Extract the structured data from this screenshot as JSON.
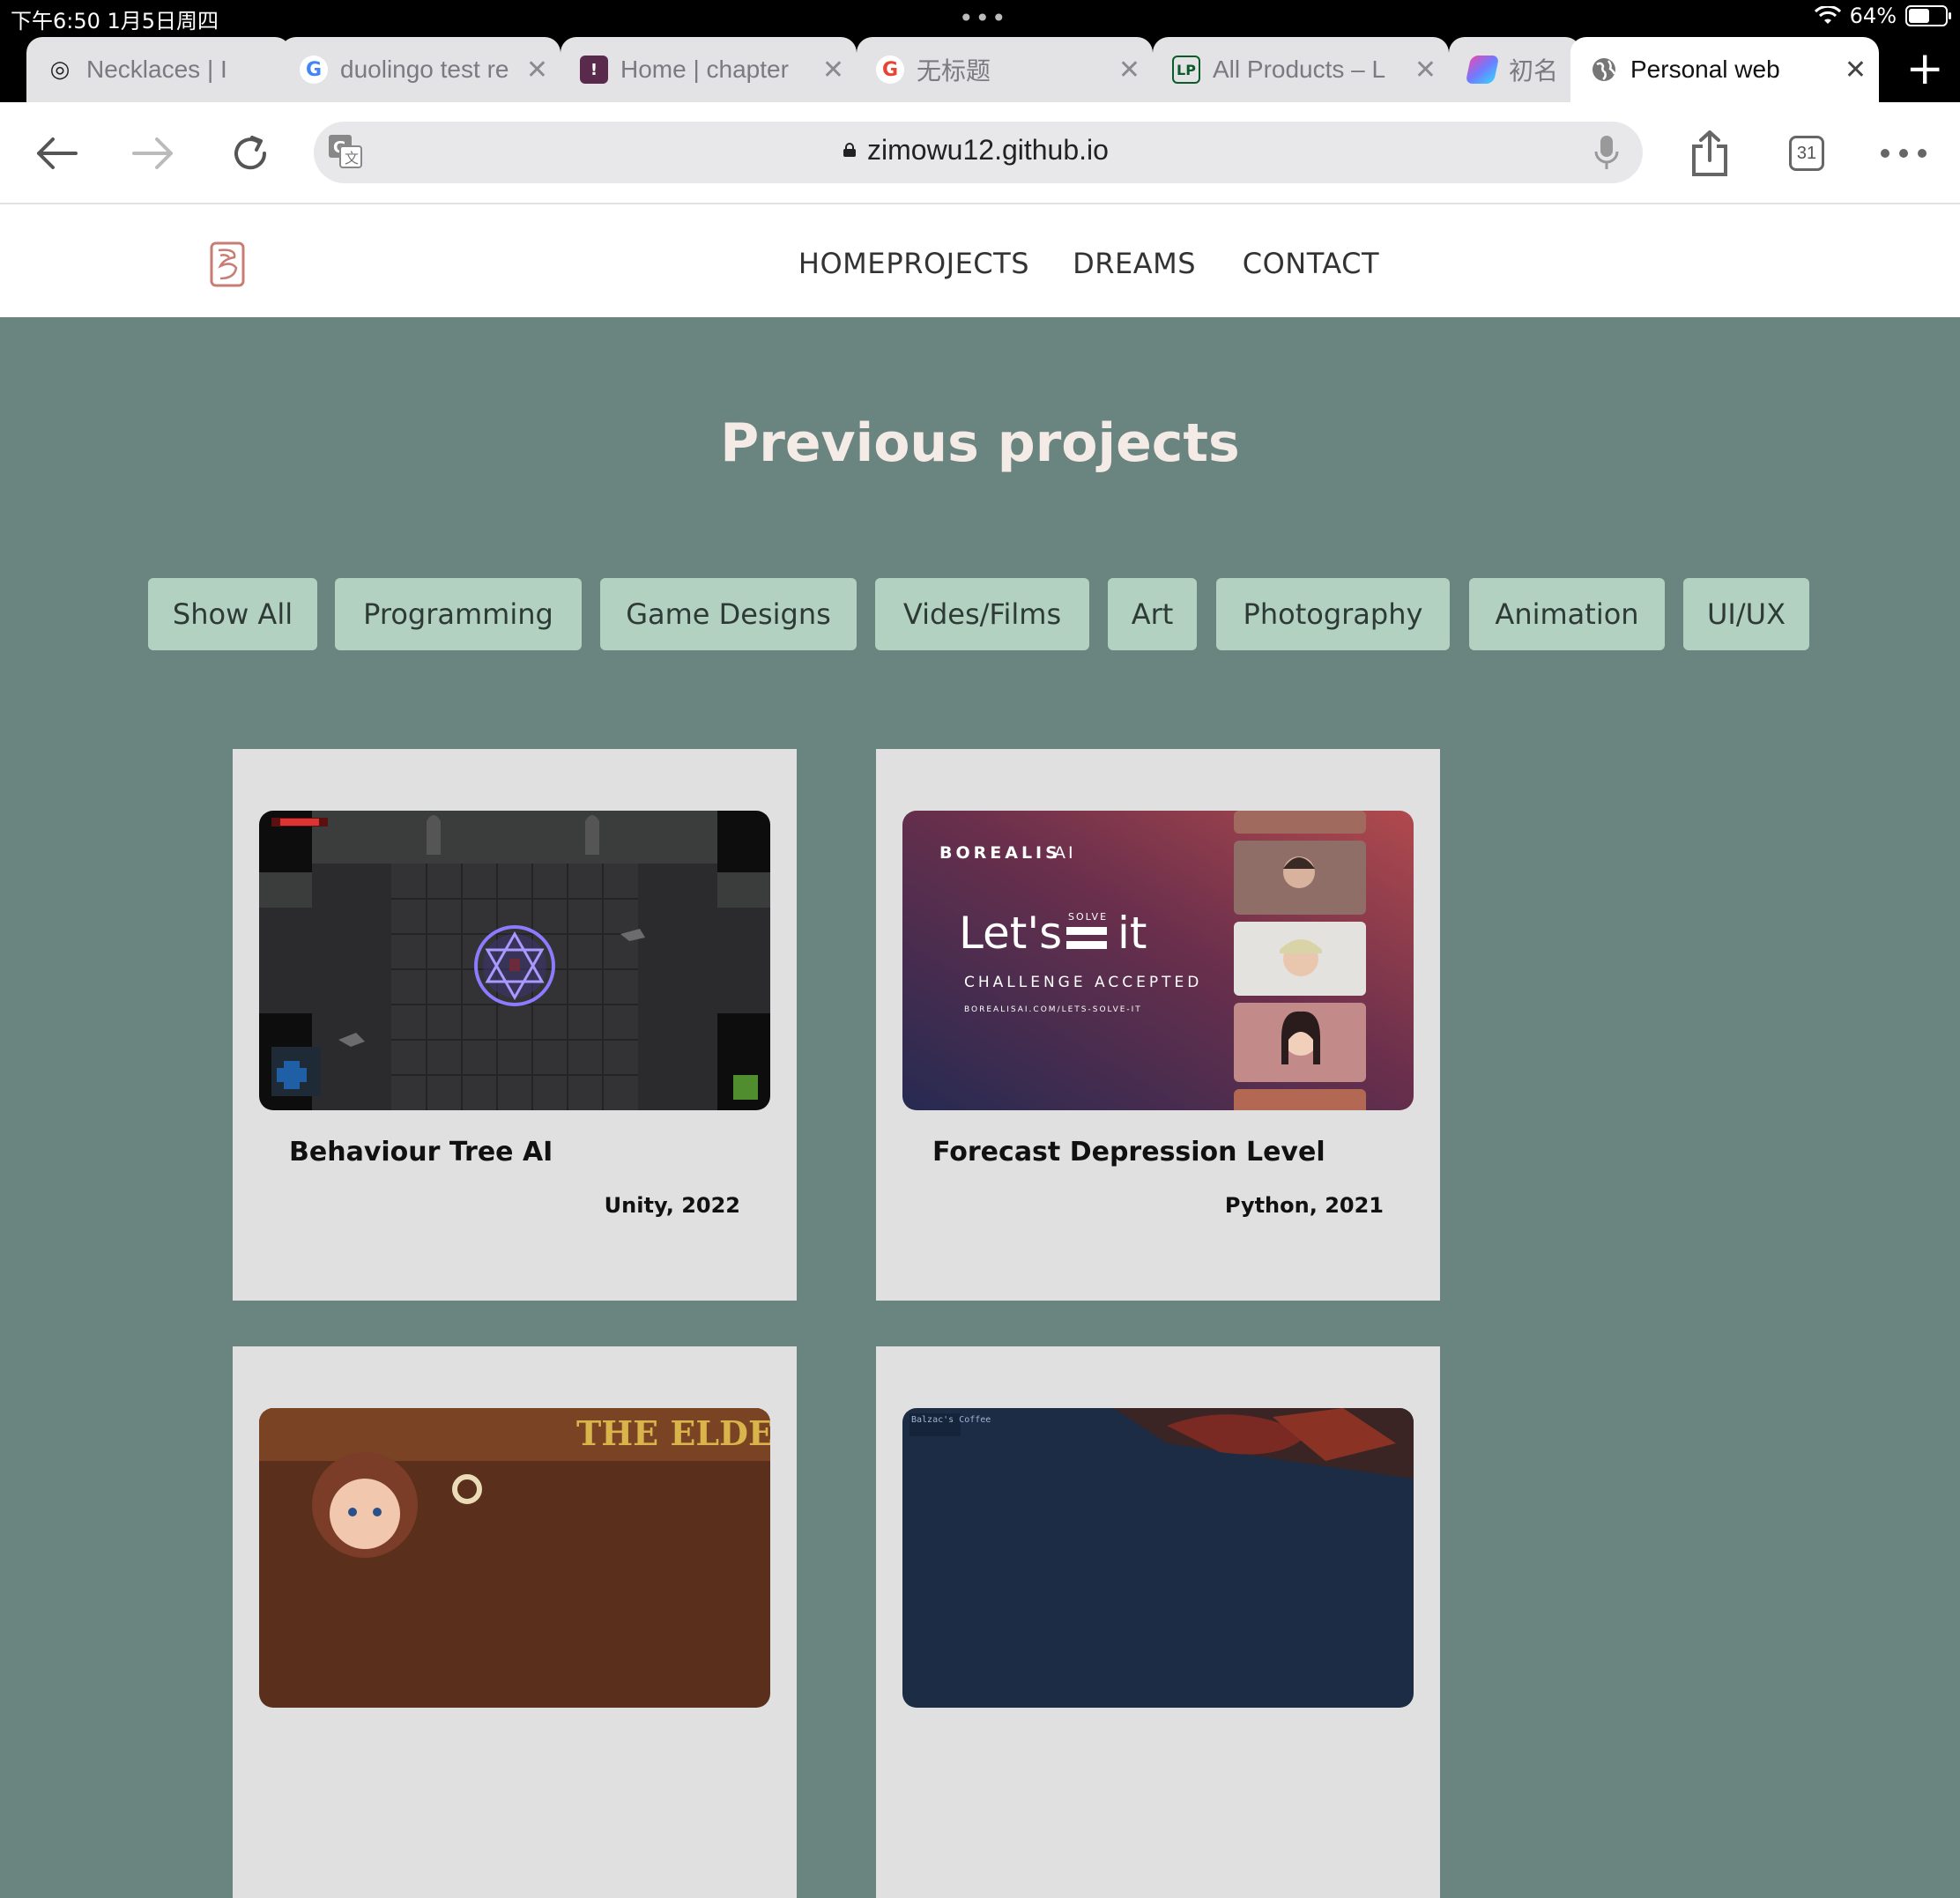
{
  "status_bar": {
    "time": "下午6:50   1月5日周四",
    "battery": "64%",
    "battery_level": 0.64
  },
  "tabs": [
    {
      "title": "Necklaces | I",
      "favicon": "ring-icon"
    },
    {
      "title": "duolingo test re",
      "favicon": "google-icon"
    },
    {
      "title": "Home | chapter",
      "favicon": "bookmark-icon"
    },
    {
      "title": "无标题",
      "favicon": "google-icon"
    },
    {
      "title": "All Products – L",
      "favicon": "lp-icon"
    },
    {
      "title": "初名",
      "favicon": "colorful-logo-icon"
    },
    {
      "title": "Personal web",
      "favicon": "globe-icon",
      "active": true
    }
  ],
  "toolbar": {
    "url": "zimowu12.github.io",
    "tab_count": "31"
  },
  "site": {
    "nav": {
      "home": "HOME",
      "projects": "PROJECTS",
      "dreams": "DREAMS",
      "contact": "CONTACT"
    },
    "heading": "Previous projects",
    "filters": [
      "Show All",
      "Programming",
      "Game Designs",
      "Vides/Films",
      "Art",
      "Photography",
      "Animation",
      "UI/UX"
    ],
    "projects": [
      {
        "title": "Behaviour Tree AI",
        "meta": "Unity, 2022"
      },
      {
        "title": "Forecast Depression Level",
        "meta": "Python, 2021",
        "thumb_text": {
          "brand": "BOREALIS",
          "brand_suffix": "AI",
          "word1": "Let's",
          "solve": "SOLVE",
          "word2": "it",
          "tagline": "CHALLENGE ACCEPTED",
          "link": "BOREALISAI.COM/LETS-SOLVE-IT"
        }
      },
      {
        "title": "",
        "meta": "",
        "thumb_text": {
          "logo": "THE ELDER"
        }
      },
      {
        "title": "",
        "meta": "",
        "thumb_text": {
          "sign": "Balzac's Coffee"
        }
      }
    ]
  },
  "colors": {
    "page_bg": "#6a8580",
    "filter_bg": "#b2d1c1",
    "card_bg": "#e0e0e0",
    "heading": "#f5ebe6"
  }
}
